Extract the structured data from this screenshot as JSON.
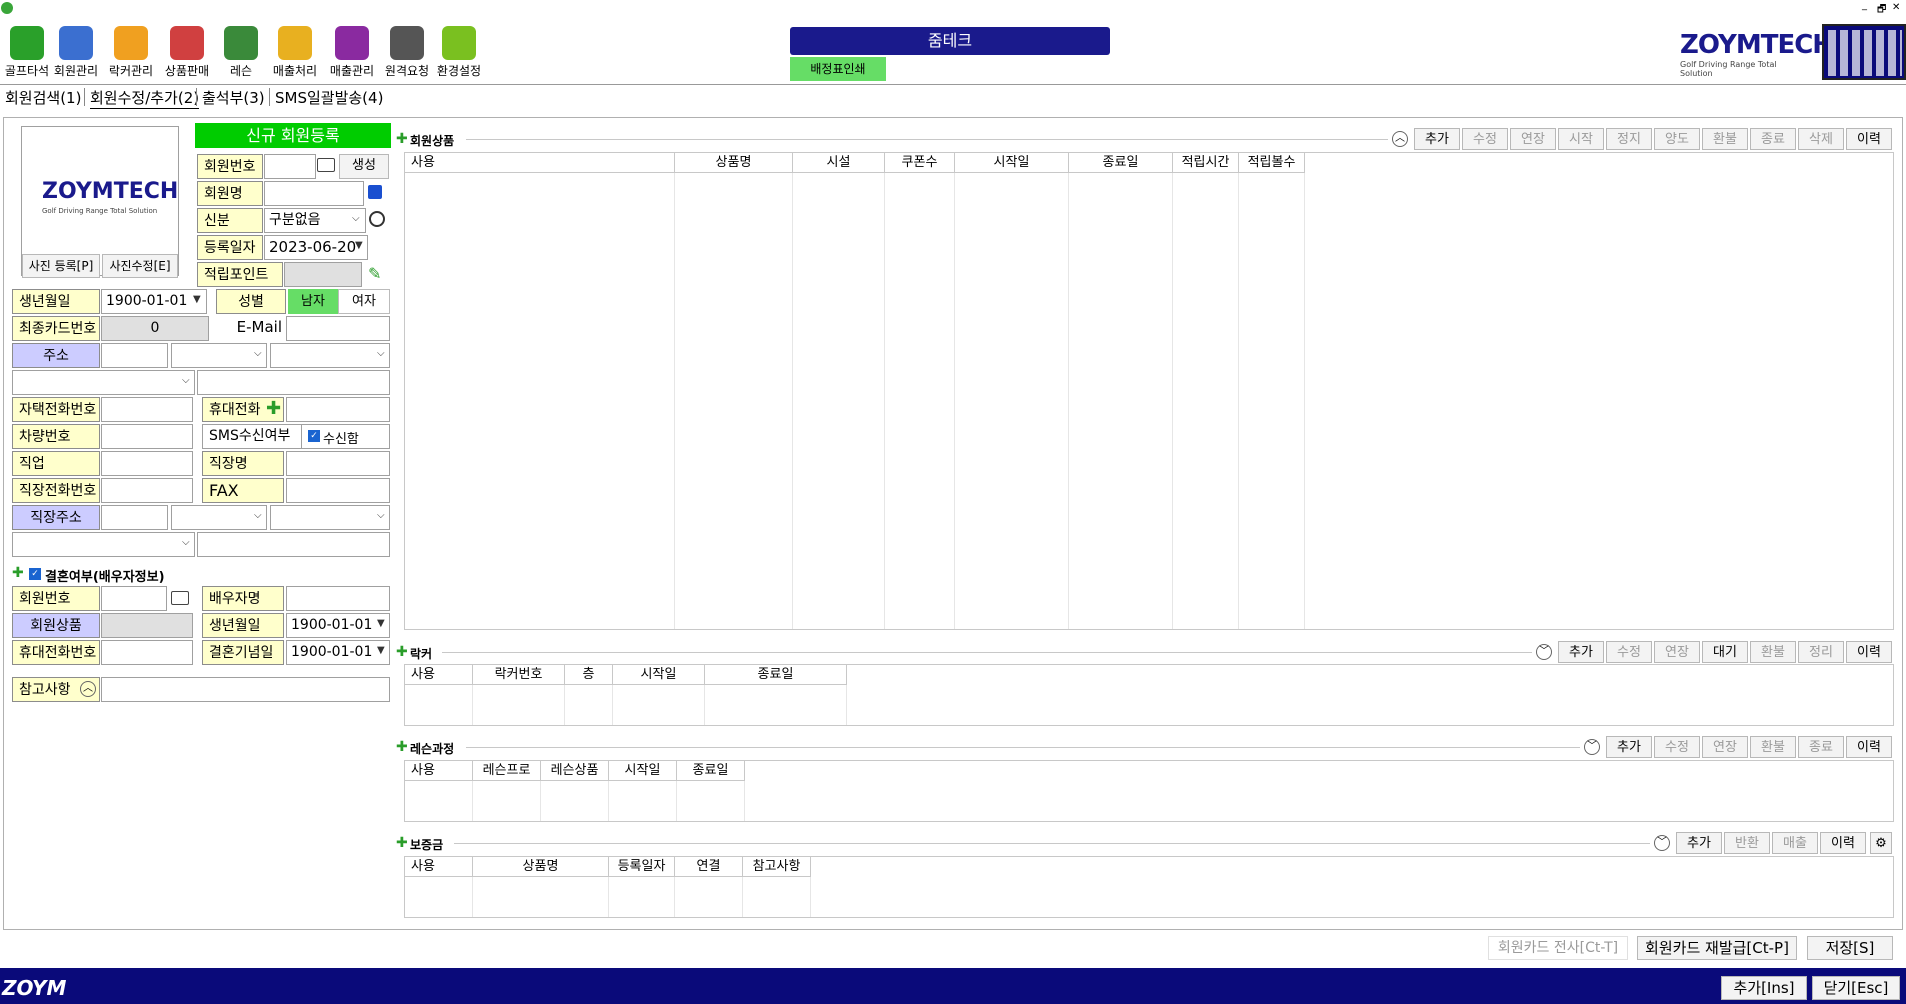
{
  "toolbar": {
    "items": [
      {
        "label": "골프타석"
      },
      {
        "label": "회원관리"
      },
      {
        "label": "락커관리"
      },
      {
        "label": "상품판매"
      },
      {
        "label": "레슨"
      },
      {
        "label": "매출처리"
      },
      {
        "label": "매출관리"
      },
      {
        "label": "원격요청"
      },
      {
        "label": "환경설정"
      }
    ]
  },
  "header": {
    "company": "줌테크",
    "print_tab": "배정표인쇄"
  },
  "brand": {
    "logo_text": "ZOYMTECH",
    "logo_sub": "Golf Driving Range Total Solution",
    "footer_logo": "ZOYM"
  },
  "window_controls": {
    "minimize": "_",
    "restore": "🗗",
    "close": "✕"
  },
  "tabs": [
    "회원검색(1)",
    "회원수정/추가(2)",
    "출석부(3)",
    "SMS일괄발송(4)"
  ],
  "member_form": {
    "title": "신규 회원등록",
    "photo_register": "사진 등록[P]",
    "photo_edit": "사진수정[E]",
    "member_no_label": "회원번호",
    "create_btn": "생성",
    "name_label": "회원명",
    "status_label": "신분",
    "status_value": "구분없음",
    "reg_date_label": "등록일자",
    "reg_date_value": "2023-06-20",
    "points_label": "적립포인트",
    "birth_label": "생년월일",
    "birth_value": "1900-01-01",
    "gender_label": "성별",
    "male": "남자",
    "female": "여자",
    "last_card_label": "최종카드번호",
    "last_card_value": "0",
    "email_label": "E-Mail",
    "address_label": "주소",
    "home_phone_label": "자택전화번호",
    "mobile_label": "휴대전화",
    "car_label": "차량번호",
    "sms_label": "SMS수신여부",
    "sms_check": "수신함",
    "job_label": "직업",
    "company_label": "직장명",
    "work_phone_label": "직장전화번호",
    "fax_label": "FAX",
    "work_address_label": "직장주소",
    "marriage_label": "결혼여부(배우자정보)",
    "spouse_no_label": "회원번호",
    "spouse_name_label": "배우자명",
    "spouse_product_label": "회원상품",
    "spouse_birth_label": "생년월일",
    "spouse_birth_value": "1900-01-01",
    "spouse_mobile_label": "휴대전화번호",
    "anniv_label": "결혼기념일",
    "anniv_value": "1900-01-01",
    "note_label": "참고사항"
  },
  "sections": {
    "products": {
      "title": "회원상품",
      "buttons": [
        "추가",
        "수정",
        "연장",
        "시작",
        "정지",
        "양도",
        "환불",
        "종료",
        "삭제",
        "이력"
      ],
      "columns": [
        "사용",
        "상품명",
        "시설",
        "쿠폰수",
        "시작일",
        "종료일",
        "적립시간",
        "적립볼수"
      ]
    },
    "locker": {
      "title": "락커",
      "buttons": [
        "추가",
        "수정",
        "연장",
        "대기",
        "환불",
        "정리",
        "이력"
      ],
      "columns": [
        "사용",
        "락커번호",
        "층",
        "시작일",
        "종료일"
      ]
    },
    "lesson": {
      "title": "레슨과정",
      "buttons": [
        "추가",
        "수정",
        "연장",
        "환불",
        "종료",
        "이력"
      ],
      "columns": [
        "사용",
        "레슨프로",
        "레슨상품",
        "시작일",
        "종료일"
      ]
    },
    "deposit": {
      "title": "보증금",
      "buttons": [
        "추가",
        "반환",
        "매출",
        "이력"
      ],
      "columns": [
        "사용",
        "상품명",
        "등록일자",
        "연결",
        "참고사항"
      ]
    }
  },
  "bottom": {
    "card_transfer": "회원카드 전사[Ct-T]",
    "card_reissue": "회원카드 재발급[Ct-P]",
    "save": "저장[S]",
    "add": "추가[Ins]",
    "close": "닫기[Esc]"
  },
  "colors": {
    "accent_green": "#00cc00",
    "header_navy": "#1a1a8c",
    "footer_navy": "#0a0a7a",
    "yellow": "#ffffcc",
    "purple": "#ccccff"
  }
}
